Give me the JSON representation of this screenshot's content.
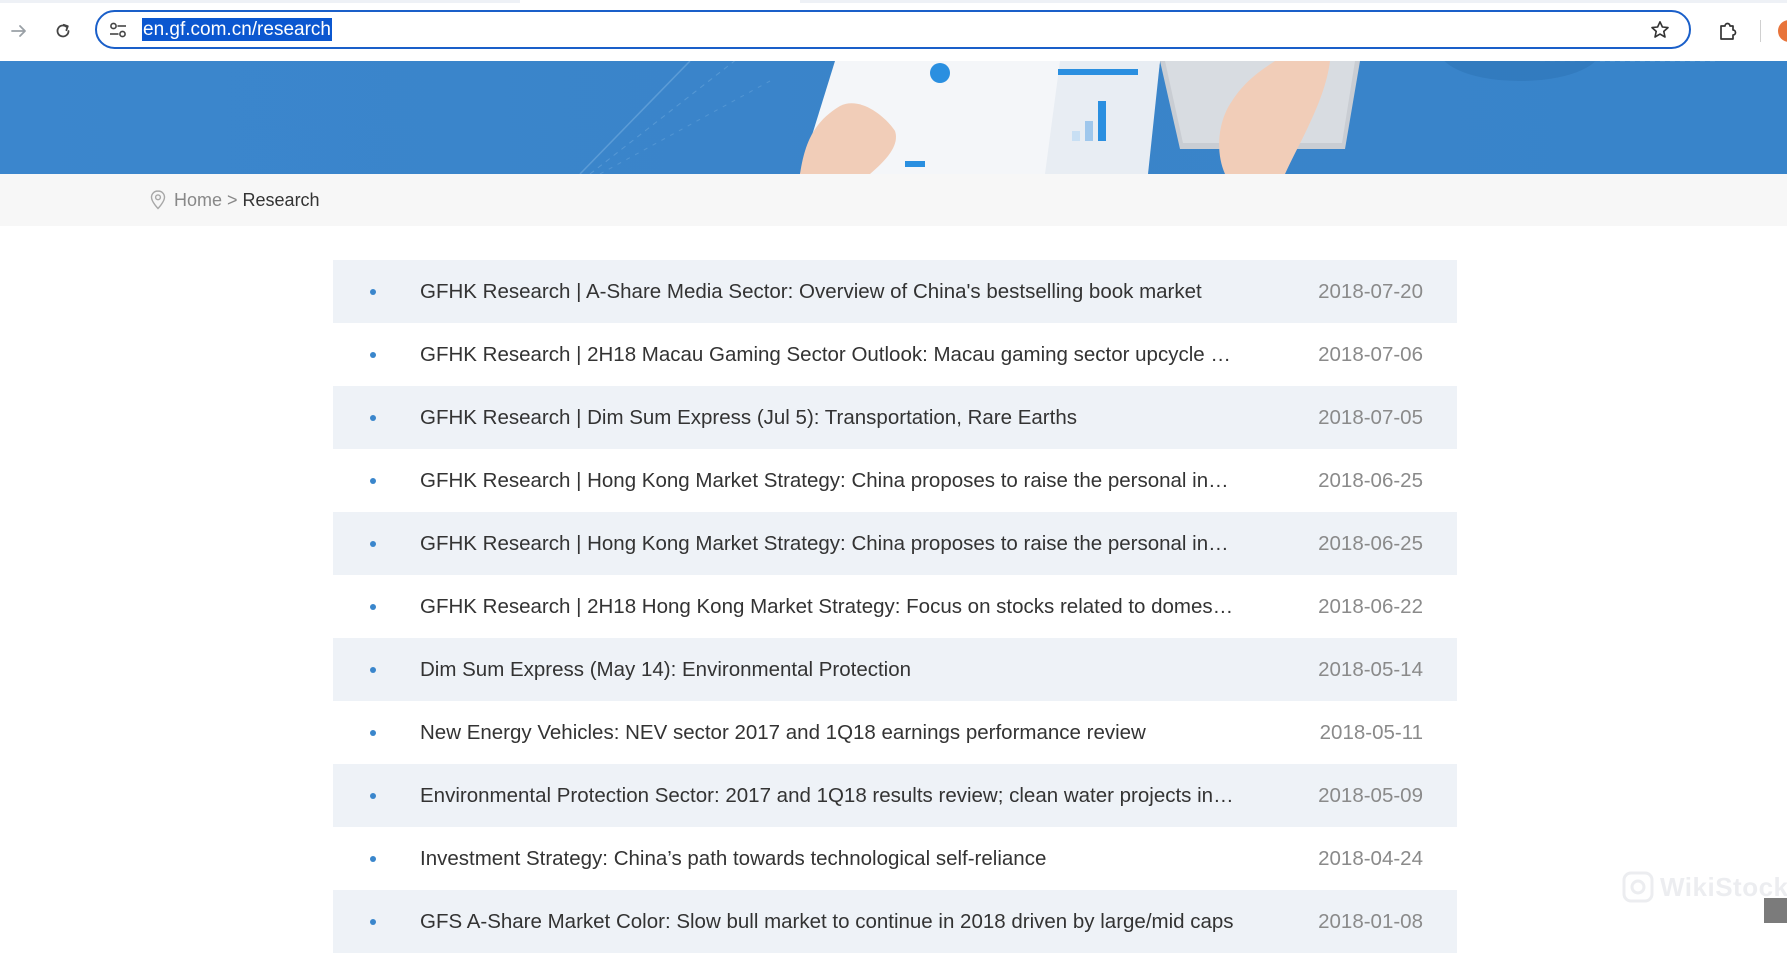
{
  "browser": {
    "url": "en.gf.com.cn/research",
    "icons": {
      "forward": "arrow-right-icon",
      "reload": "reload-icon",
      "site_settings": "tune-icon",
      "bookmark": "star-icon",
      "extensions": "puzzle-icon",
      "profile": "profile-avatar-icon"
    }
  },
  "breadcrumb": {
    "icon": "location-pin-icon",
    "home": "Home",
    "separator": ">",
    "current": "Research"
  },
  "research_list": {
    "items": [
      {
        "title": "GFHK Research | A-Share Media Sector: Overview of China's bestselling book market",
        "date": "2018-07-20"
      },
      {
        "title": "GFHK Research | 2H18 Macau Gaming Sector Outlook: Macau gaming sector upcycle continues",
        "date": "2018-07-06"
      },
      {
        "title": "GFHK Research | Dim Sum Express (Jul 5): Transportation, Rare Earths",
        "date": "2018-07-05"
      },
      {
        "title": "GFHK Research | Hong Kong Market Strategy: China proposes to raise the personal income tax threshold",
        "date": "2018-06-25"
      },
      {
        "title": "GFHK Research | Hong Kong Market Strategy: China proposes to raise the personal income tax threshold",
        "date": "2018-06-25"
      },
      {
        "title": "GFHK Research | 2H18 Hong Kong Market Strategy: Focus on stocks related to domestic consumption",
        "date": "2018-06-22"
      },
      {
        "title": "Dim Sum Express (May 14): Environmental Protection",
        "date": "2018-05-14"
      },
      {
        "title": "New Energy Vehicles: NEV sector 2017 and 1Q18 earnings performance review",
        "date": "2018-05-11"
      },
      {
        "title": "Environmental Protection Sector: 2017 and 1Q18 results review; clean water projects in focus",
        "date": "2018-05-09"
      },
      {
        "title": "Investment Strategy: China’s path towards technological self-reliance",
        "date": "2018-04-24"
      },
      {
        "title": "GFS A-Share Market Color: Slow bull market to continue in 2018 driven by large/mid caps",
        "date": "2018-01-08"
      }
    ]
  },
  "watermark": {
    "text": "WikiStock"
  },
  "colors": {
    "accent": "#3a86cc",
    "omnibox_border": "#1a5fc9",
    "url_selection": "#0b57d0",
    "row_alt": "#eef2f7",
    "date_text": "#8a8a8a"
  }
}
